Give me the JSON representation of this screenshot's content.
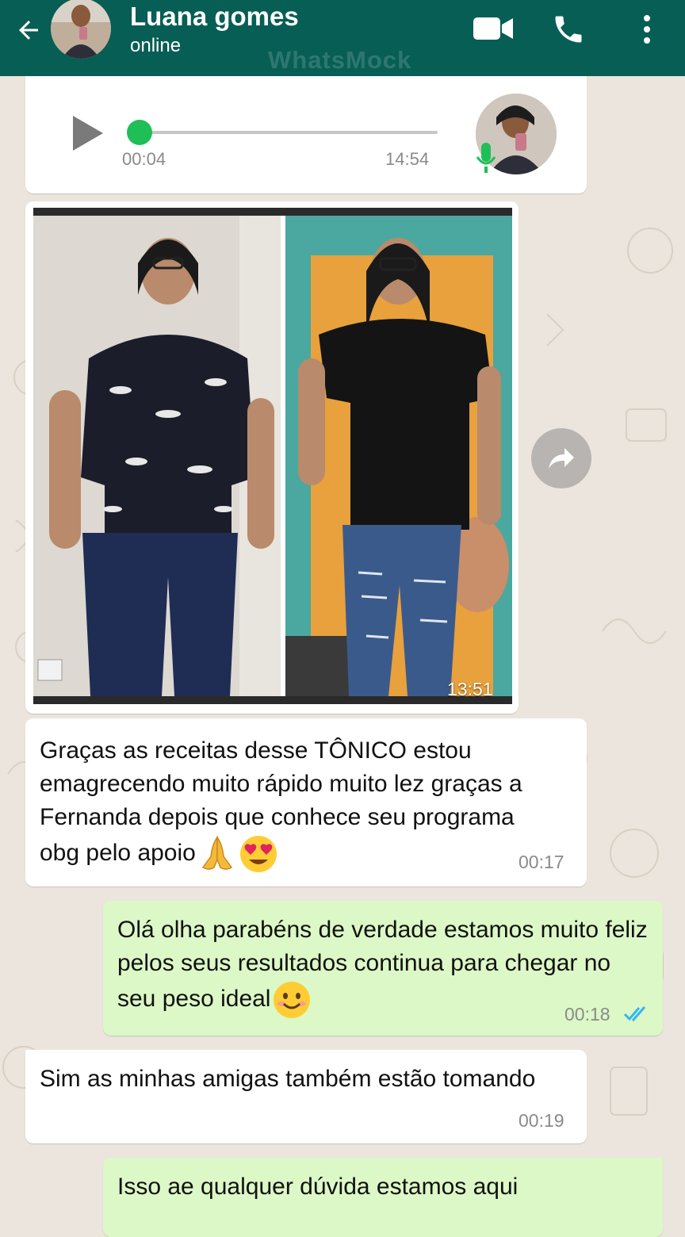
{
  "header": {
    "contact_name": "Luana gomes",
    "status": "online",
    "watermark": "WhatsMock",
    "color": "#075e54",
    "icons": [
      "back-arrow-icon",
      "video-call-icon",
      "phone-call-icon",
      "more-vert-icon"
    ]
  },
  "audio_message": {
    "elapsed": "00:04",
    "time": "14:54",
    "progress_fraction": 0.02,
    "accent": "#1fbf57"
  },
  "image_message": {
    "time": "13:51"
  },
  "messages": [
    {
      "direction": "incoming",
      "text": "Graças as receitas desse TÔNICO estou emagrecendo muito rápido muito lez graças a Fernanda depois que conhece seu programa obg pelo apoio",
      "emojis": [
        "praying-hands-emoji",
        "heart-eyes-emoji"
      ],
      "time": "00:17"
    },
    {
      "direction": "outgoing",
      "text": "Olá olha parabéns de verdade estamos muito feliz pelos seus resultados continua para chegar no seu peso ideal",
      "emojis": [
        "smiling-face-emoji"
      ],
      "time": "00:18",
      "status": "read"
    },
    {
      "direction": "incoming",
      "text": "Sim as minhas amigas também estão tomando",
      "time": "00:19"
    },
    {
      "direction": "outgoing",
      "text": "Isso ae qualquer dúvida estamos aqui"
    }
  ],
  "colors": {
    "incoming_bubble": "#ffffff",
    "outgoing_bubble": "#dcf8c6",
    "read_ticks": "#34b7f1",
    "chat_background": "#ece5dd"
  }
}
